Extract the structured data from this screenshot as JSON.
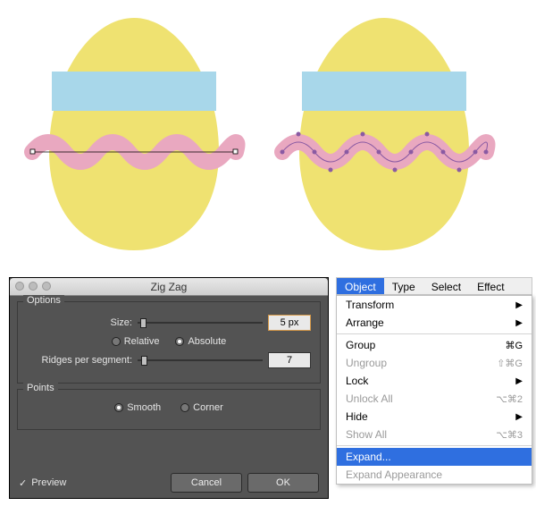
{
  "artwork": {
    "egg_fill": "#efe271",
    "band_fill": "#a8d7ea",
    "wave_fill": "#e9a8c0",
    "wave_stroke_selected": "#8a5aa3"
  },
  "dialog": {
    "title": "Zig Zag",
    "options_label": "Options",
    "size_label": "Size:",
    "size_value": "5 px",
    "size_slider_pos": 0.02,
    "relative_label": "Relative",
    "absolute_label": "Absolute",
    "size_mode": "Absolute",
    "ridges_label": "Ridges per segment:",
    "ridges_value": "7",
    "ridges_slider_pos": 0.03,
    "points_label": "Points",
    "smooth_label": "Smooth",
    "corner_label": "Corner",
    "points_mode": "Smooth",
    "preview_label": "Preview",
    "preview_checked": true,
    "cancel_label": "Cancel",
    "ok_label": "OK"
  },
  "menubar": {
    "items": [
      "Object",
      "Type",
      "Select",
      "Effect"
    ],
    "active": "Object"
  },
  "menu": {
    "sections": [
      [
        {
          "label": "Transform",
          "submenu": true
        },
        {
          "label": "Arrange",
          "submenu": true
        }
      ],
      [
        {
          "label": "Group",
          "shortcut": "⌘G"
        },
        {
          "label": "Ungroup",
          "shortcut": "⇧⌘G",
          "disabled": true
        },
        {
          "label": "Lock",
          "submenu": true
        },
        {
          "label": "Unlock All",
          "shortcut": "⌥⌘2",
          "disabled": true
        },
        {
          "label": "Hide",
          "submenu": true
        },
        {
          "label": "Show All",
          "shortcut": "⌥⌘3",
          "disabled": true
        }
      ],
      [
        {
          "label": "Expand...",
          "highlight": true
        },
        {
          "label": "Expand Appearance",
          "disabled": true
        }
      ]
    ]
  }
}
